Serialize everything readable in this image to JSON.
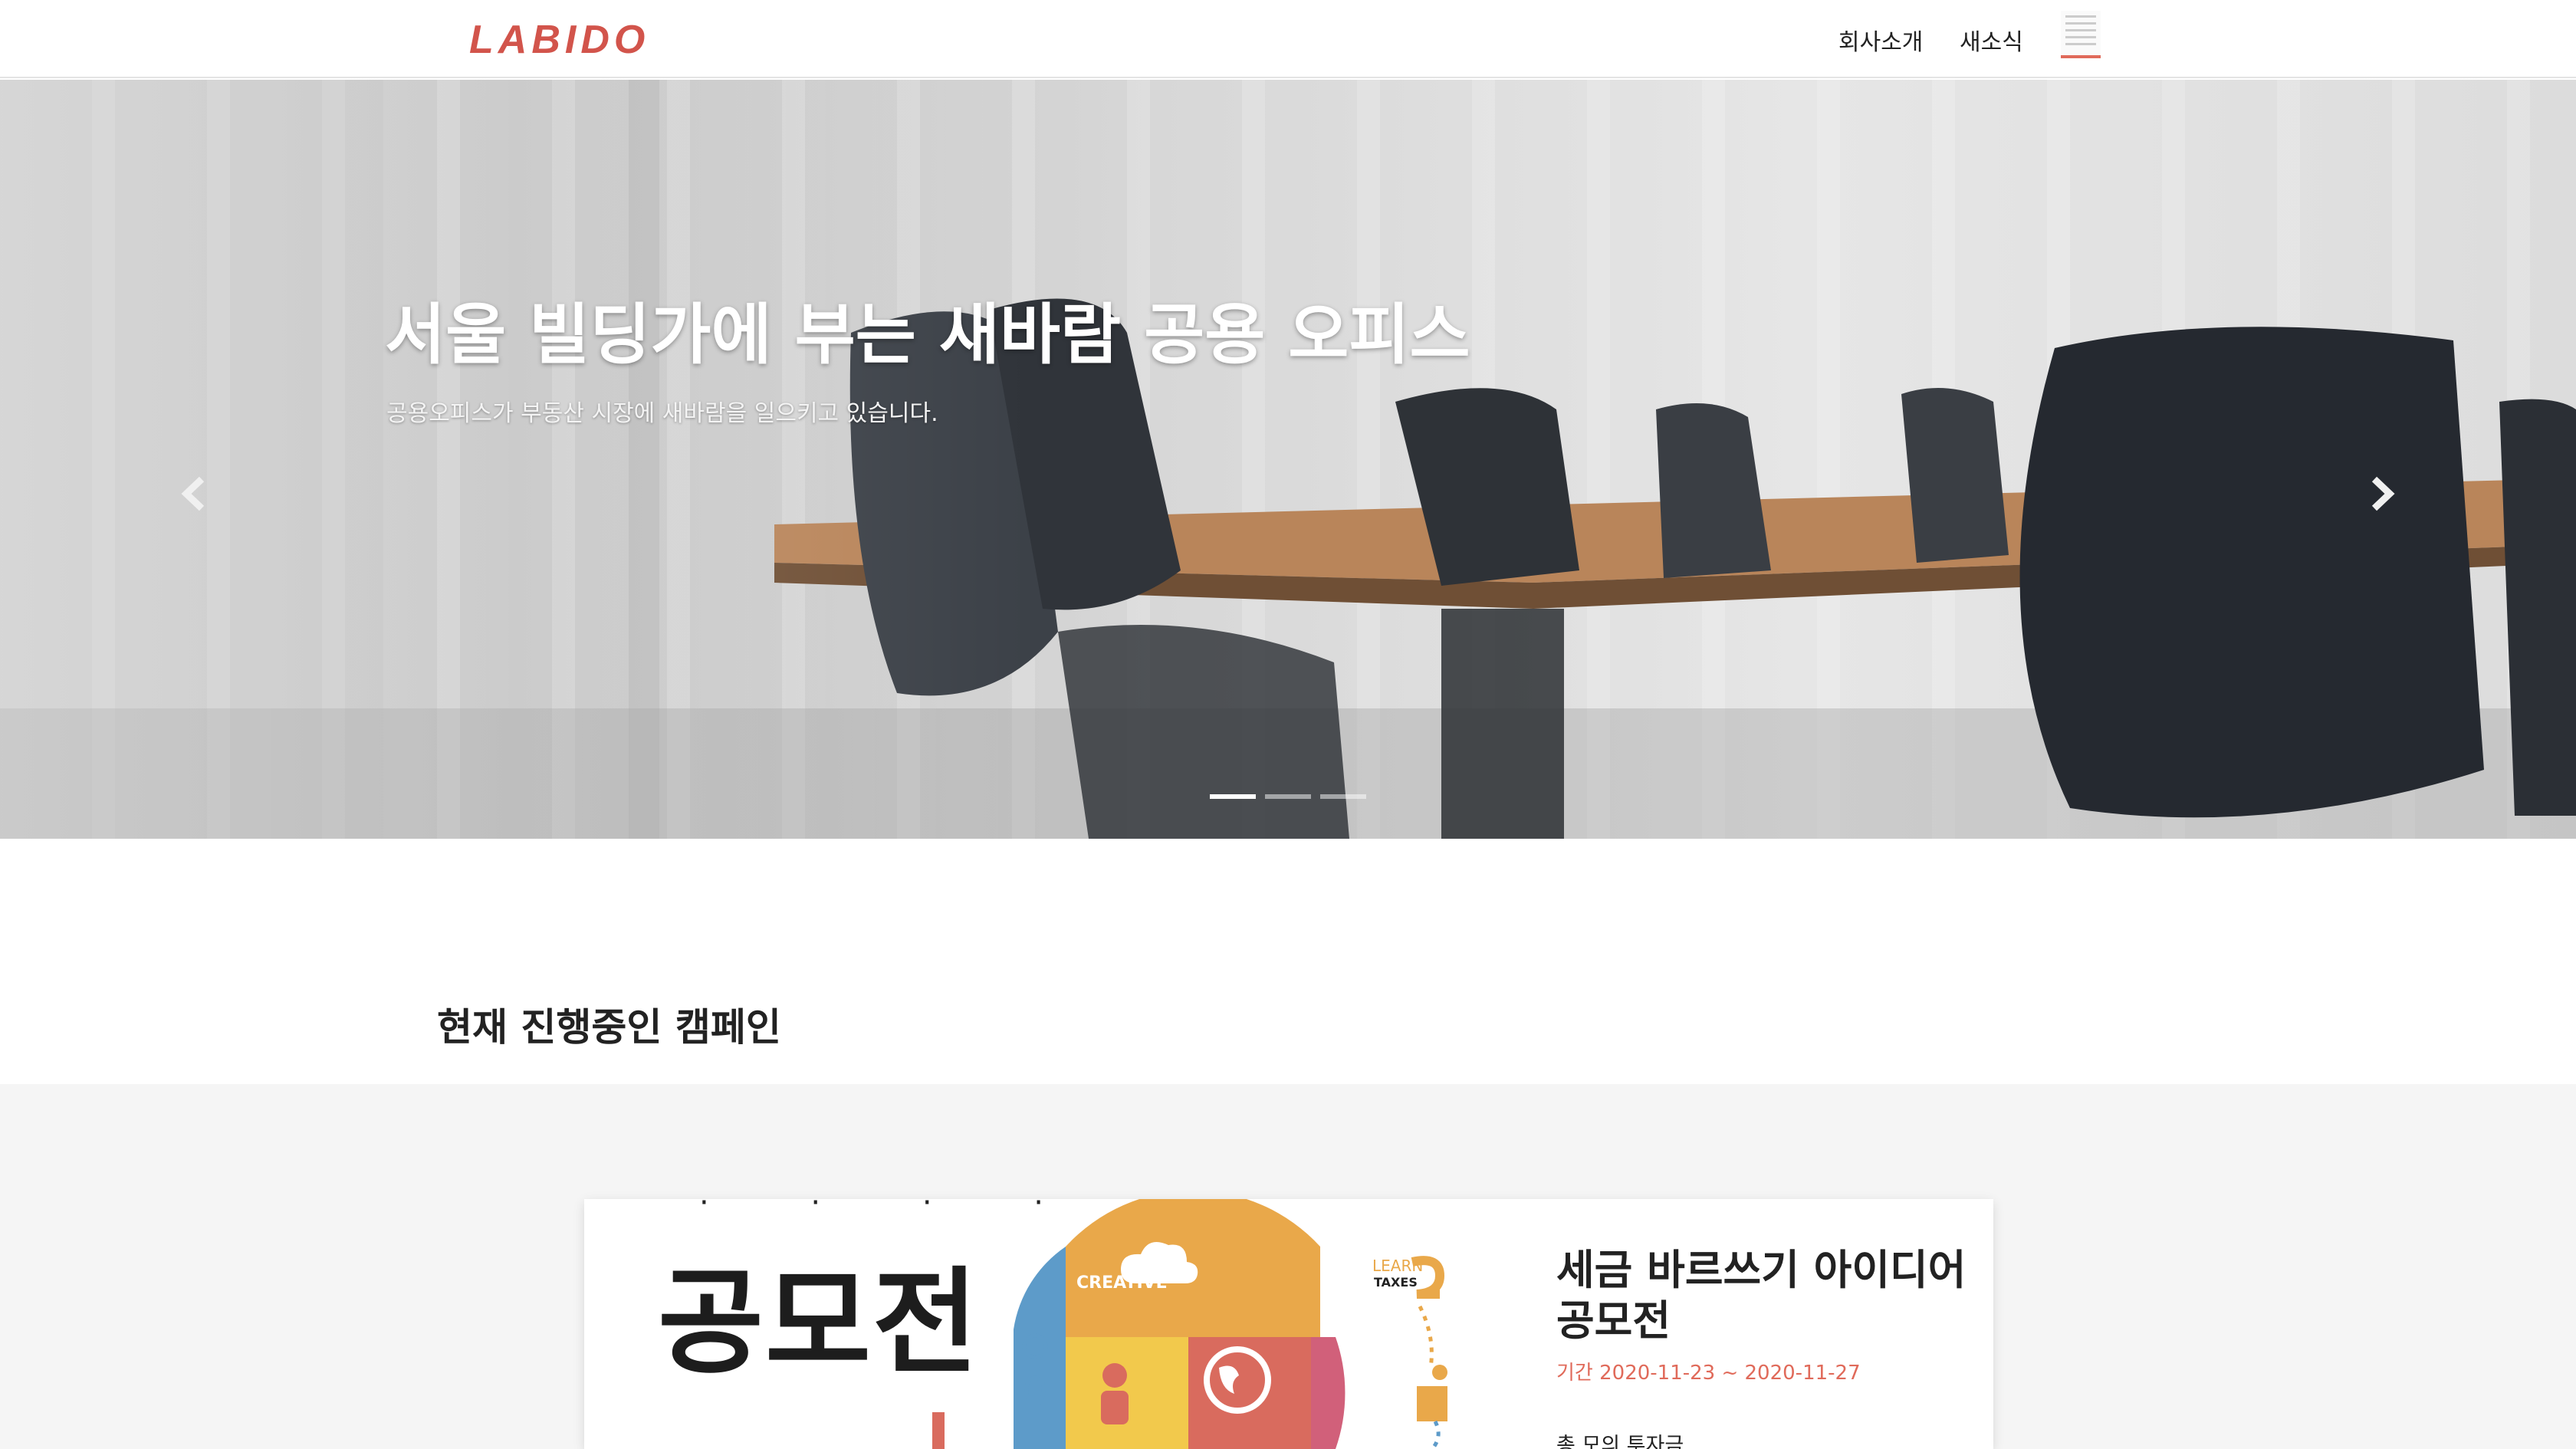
{
  "nav": {
    "logo": "LABIDO",
    "links": [
      "회사소개",
      "새소식"
    ]
  },
  "hero": {
    "title": "서울 빌딩가에 부는 새바람 공용 오피스",
    "subtitle": "공용오피스가 부동산 시장에 새바람을 일으키고 있습니다.",
    "slide_count": 3,
    "active_slide": 1
  },
  "section": {
    "title": "현재 진행중인 캠페인"
  },
  "campaign": {
    "poster_text": "공모전",
    "poster_labels": [
      "CREATIVE",
      "LEARN",
      "TAXES"
    ],
    "title": "세금 바르쓰기 아이디어 공모전",
    "date": "기간 2020-11-23 ~ 2020-11-27",
    "fund_label": "총 모의 투자금"
  },
  "colors": {
    "brand": "#d2544b",
    "accent": "#e06a5a",
    "puzzle": [
      "#e9a84a",
      "#f2c94c",
      "#d96b5e",
      "#d1607a",
      "#5d9bc9",
      "#4a7fbf"
    ]
  }
}
